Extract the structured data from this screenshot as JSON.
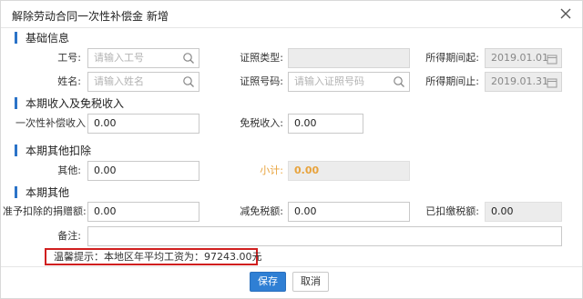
{
  "dialog": {
    "title": "解除劳动合同一次性补偿金 新增"
  },
  "sections": {
    "basic": "基础信息",
    "income": "本期收入及免税收入",
    "other_deduction": "本期其他扣除",
    "other": "本期其他"
  },
  "basic": {
    "employee_id_label": "工号:",
    "employee_id_placeholder": "请输入工号",
    "name_label": "姓名:",
    "name_placeholder": "请输入姓名",
    "id_type_label": "证照类型:",
    "id_type_value": "",
    "id_number_label": "证照号码:",
    "id_number_placeholder": "请输入证照号码",
    "period_start_label": "所得期间起:",
    "period_start_value": "2019.01.01",
    "period_end_label": "所得期间止:",
    "period_end_value": "2019.01.31"
  },
  "income": {
    "lump_sum_label": "一次性补偿收入",
    "lump_sum_value": "0.00",
    "tax_exempt_label": "免税收入:",
    "tax_exempt_value": "0.00"
  },
  "other_deduction": {
    "other_label": "其他:",
    "other_value": "0.00",
    "subtotal_label": "小计:",
    "subtotal_value": "0.00"
  },
  "other": {
    "donation_label": "准予扣除的捐赠额:",
    "donation_value": "0.00",
    "tax_reduction_label": "减免税额:",
    "tax_reduction_value": "0.00",
    "withheld_label": "已扣缴税额:",
    "withheld_value": "0.00",
    "remark_label": "备注:",
    "remark_value": ""
  },
  "tip": "温馨提示：本地区年平均工资为：97243.00元",
  "buttons": {
    "save": "保存",
    "cancel": "取消"
  },
  "colors": {
    "accent": "#2f7fd4",
    "section_bar": "#2b73c8",
    "subtotal": "#e8a33c",
    "tip_border": "#d01f1f"
  },
  "icons": {
    "close": "close-icon",
    "search": "search-icon",
    "calendar": "calendar-icon"
  }
}
